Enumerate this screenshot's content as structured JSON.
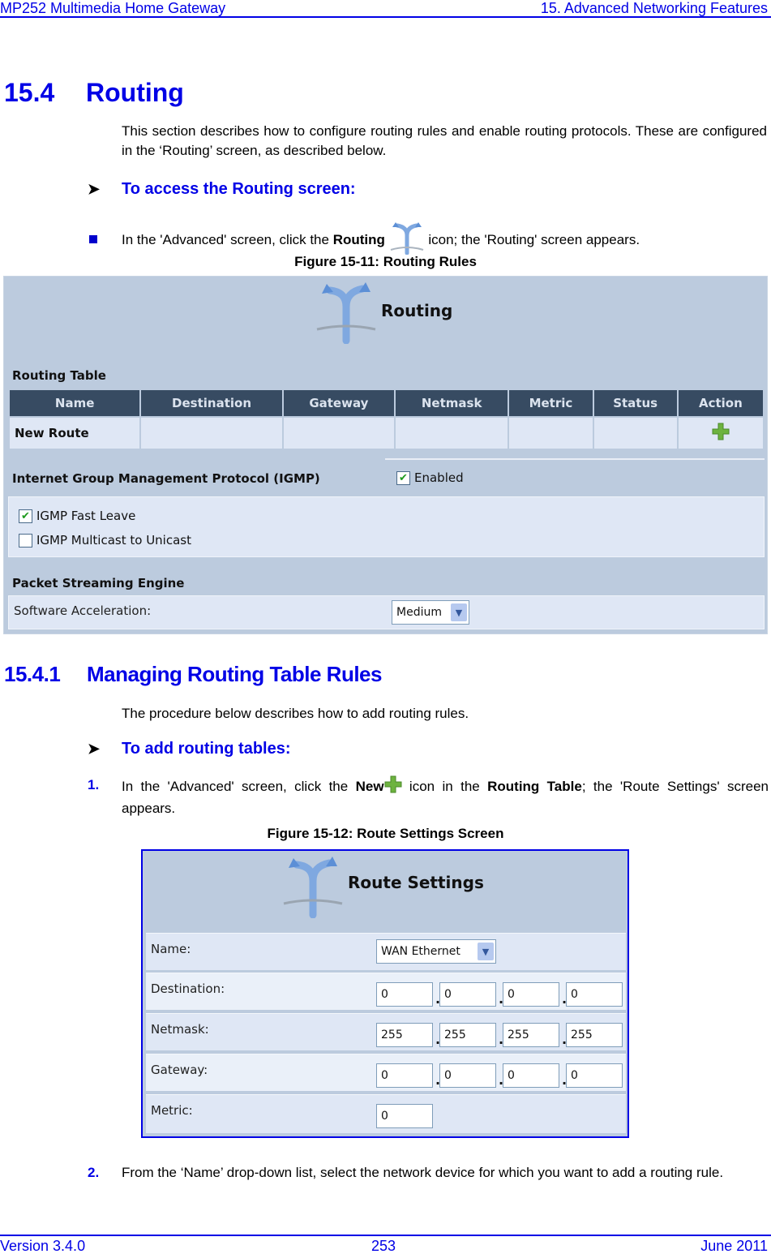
{
  "header": {
    "left": "MP252 Multimedia Home Gateway",
    "right": "15. Advanced Networking Features"
  },
  "section": {
    "number": "15.4",
    "title": "Routing",
    "intro": "This section describes how to configure routing rules and enable routing protocols. These are configured in the ‘Routing’ screen, as described below.",
    "procedure_title": "To access the Routing screen:",
    "bullet": {
      "before": "In the 'Advanced' screen, click the ",
      "bold": "Routing",
      "after": " icon; the 'Routing' screen appears."
    },
    "figure_caption": "Figure 15-11: Routing Rules"
  },
  "routing_screen": {
    "title": "Routing",
    "table_label": "Routing Table",
    "columns": [
      "Name",
      "Destination",
      "Gateway",
      "Netmask",
      "Metric",
      "Status",
      "Action"
    ],
    "rows": [
      {
        "name": "New Route",
        "destination": "",
        "gateway": "",
        "netmask": "",
        "metric": "",
        "status": "",
        "action_icon": "add-icon"
      }
    ],
    "igmp_label": "Internet Group Management Protocol (IGMP)",
    "igmp_enabled_label": "Enabled",
    "igmp_enabled": true,
    "options": [
      {
        "label": "IGMP Fast Leave",
        "checked": true
      },
      {
        "label": "IGMP Multicast to Unicast",
        "checked": false
      }
    ],
    "pse_label": "Packet Streaming Engine",
    "accel_label": "Software Acceleration:",
    "accel_value": "Medium"
  },
  "subsection": {
    "number": "15.4.1",
    "title": "Managing Routing Table Rules",
    "intro": "The procedure below describes how to add routing rules.",
    "procedure_title": "To add routing tables:",
    "step1": {
      "num": "1.",
      "a": "In the 'Advanced' screen, click the ",
      "b": "New",
      "c": " icon in the ",
      "d": "Routing Table",
      "e": "; the 'Route Settings' screen appears."
    },
    "figure_caption": "Figure 15-12: Route Settings Screen",
    "step2": {
      "num": "2.",
      "text": "From the ‘Name’ drop-down list, select the network device for which you want to add a routing rule."
    }
  },
  "route_settings": {
    "title": "Route Settings",
    "name_label": "Name:",
    "name_value": "WAN Ethernet",
    "destination_label": "Destination:",
    "destination": [
      "0",
      "0",
      "0",
      "0"
    ],
    "netmask_label": "Netmask:",
    "netmask": [
      "255",
      "255",
      "255",
      "255"
    ],
    "gateway_label": "Gateway:",
    "gateway": [
      "0",
      "0",
      "0",
      "0"
    ],
    "metric_label": "Metric:",
    "metric": "0"
  },
  "footer": {
    "version": "Version 3.4.0",
    "page": "253",
    "date": "June 2011"
  }
}
